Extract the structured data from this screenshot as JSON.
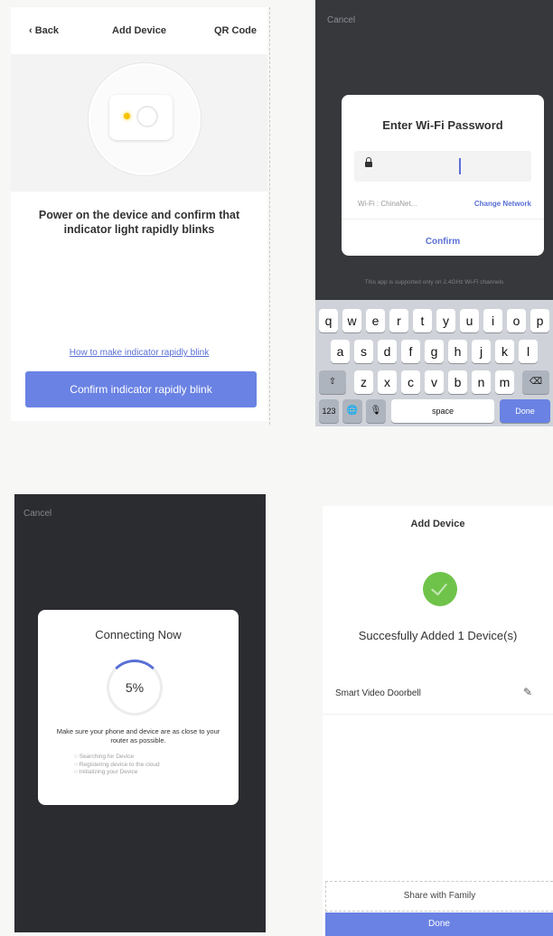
{
  "screen1": {
    "back_label": "Back",
    "title": "Add Device",
    "qr_label": "QR Code",
    "instruction": "Power on the device and confirm that indicator light rapidly blinks",
    "help_link": "How to make indicator rapidly blink",
    "confirm_button": "Confirm indicator rapidly blink",
    "icons": [
      "chevron-left-icon",
      "indicator-led-icon",
      "camera-lens-icon"
    ],
    "led_color": "#f5c400",
    "accent_color": "#6a82e3"
  },
  "screen2": {
    "cancel_label": "Cancel",
    "dialog_title": "Enter Wi-Fi Password",
    "password_value": "",
    "wifi_line": "Wi-Fi : ChinaNet...",
    "change_network": "Change Network",
    "confirm_label": "Confirm",
    "note": "This app is supported only on 2.4GHz Wi-Fi channels",
    "keyboard": {
      "row1": [
        "q",
        "w",
        "e",
        "r",
        "t",
        "y",
        "u",
        "i",
        "o",
        "p"
      ],
      "row2": [
        "a",
        "s",
        "d",
        "f",
        "g",
        "h",
        "j",
        "k",
        "l"
      ],
      "row3": [
        "z",
        "x",
        "c",
        "v",
        "b",
        "n",
        "m"
      ],
      "shift": "⇧",
      "backspace": "⌫",
      "numbers": "123",
      "globe": "🌐",
      "mic": "🎙",
      "space": "space",
      "done": "Done"
    },
    "icons": [
      "lock-icon"
    ]
  },
  "screen3": {
    "cancel_label": "Cancel",
    "dialog_title": "Connecting Now",
    "progress_percent": "5%",
    "progress_value": 0.05,
    "message": "Make sure your phone and device are as close to your router as possible.",
    "steps": [
      "○ Searching for Device",
      "○ Registering device to the cloud",
      "○ Initializing your Device"
    ]
  },
  "screen4": {
    "title": "Add Device",
    "success_text": "Succesfully Added 1 Device(s)",
    "device_name": "Smart  Video Doorbell",
    "edit_icon": "✎",
    "share_label": "Share with Family",
    "done_label": "Done",
    "success_color": "#6fc34a"
  }
}
